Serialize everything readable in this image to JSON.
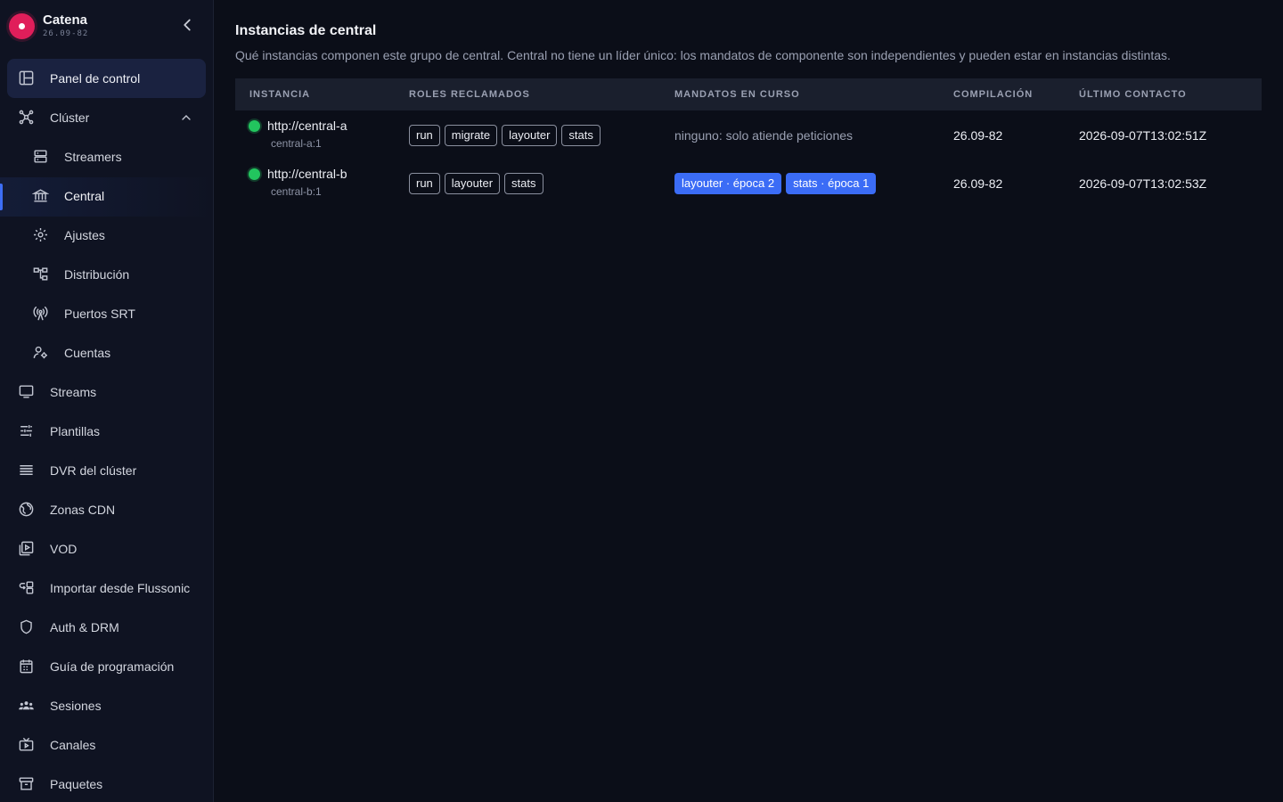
{
  "brand": {
    "name": "Catena",
    "version": "26.09-82"
  },
  "sidebar": {
    "items": [
      {
        "label": "Panel de control",
        "icon": "dashboard-icon"
      },
      {
        "label": "Clúster",
        "icon": "cluster-icon"
      },
      {
        "label": "Streamers",
        "icon": "server-icon"
      },
      {
        "label": "Central",
        "icon": "bank-icon"
      },
      {
        "label": "Ajustes",
        "icon": "gear-icon"
      },
      {
        "label": "Distribución",
        "icon": "distribution-icon"
      },
      {
        "label": "Puertos SRT",
        "icon": "antenna-icon"
      },
      {
        "label": "Cuentas",
        "icon": "accounts-icon"
      },
      {
        "label": "Streams",
        "icon": "monitor-icon"
      },
      {
        "label": "Plantillas",
        "icon": "sliders-icon"
      },
      {
        "label": "DVR del clúster",
        "icon": "list-icon"
      },
      {
        "label": "Zonas CDN",
        "icon": "globe-icon"
      },
      {
        "label": "VOD",
        "icon": "video-library-icon"
      },
      {
        "label": "Importar desde Flussonic",
        "icon": "import-icon"
      },
      {
        "label": "Auth & DRM",
        "icon": "shield-icon"
      },
      {
        "label": "Guía de programación",
        "icon": "calendar-icon"
      },
      {
        "label": "Sesiones",
        "icon": "users-icon"
      },
      {
        "label": "Canales",
        "icon": "tv-icon"
      },
      {
        "label": "Paquetes",
        "icon": "archive-icon"
      }
    ]
  },
  "page": {
    "title": "Instancias de central",
    "subtitle": "Qué instancias componen este grupo de central. Central no tiene un líder único: los mandatos de componente son independientes y pueden estar en instancias distintas."
  },
  "table": {
    "headers": {
      "instance": "INSTANCIA",
      "roles": "ROLES RECLAMADOS",
      "mandates": "MANDATOS EN CURSO",
      "build": "COMPILACIÓN",
      "last_contact": "ÚLTIMO CONTACTO"
    },
    "rows": [
      {
        "url": "http://central-a",
        "id": "central-a:1",
        "status_color": "#22c55e",
        "roles": [
          "run",
          "migrate",
          "layouter",
          "stats"
        ],
        "mandates": [],
        "mandates_text": "ninguno: solo atiende peticiones",
        "build": "26.09-82",
        "last_contact": "2026-09-07T13:02:51Z"
      },
      {
        "url": "http://central-b",
        "id": "central-b:1",
        "status_color": "#22c55e",
        "roles": [
          "run",
          "layouter",
          "stats"
        ],
        "mandates": [
          "layouter · época 2",
          "stats · época 1"
        ],
        "mandates_text": "",
        "build": "26.09-82",
        "last_contact": "2026-09-07T13:02:53Z"
      }
    ]
  },
  "colors": {
    "accent": "#3b6cf6",
    "status_ok": "#22c55e",
    "brand": "#e01e5a"
  }
}
